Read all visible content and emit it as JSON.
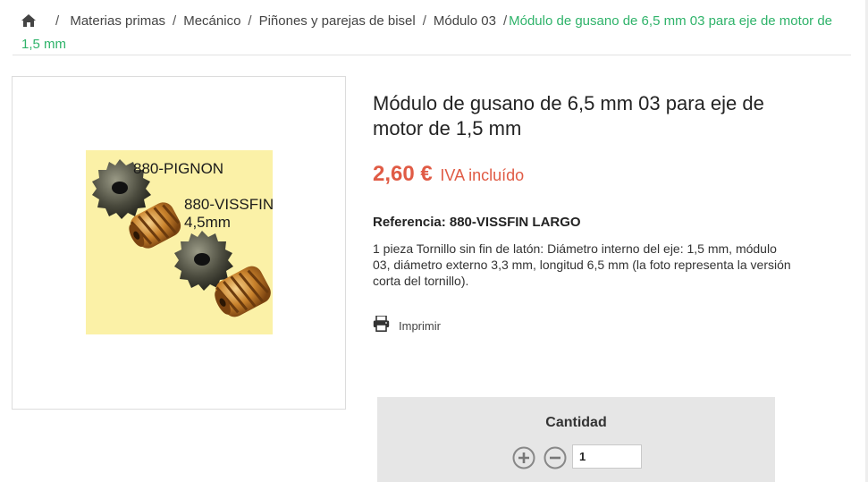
{
  "breadcrumb": {
    "home_icon": "home-icon",
    "items": [
      "Materias primas",
      "Mecánico",
      "Piñones y parejas de bisel",
      "Módulo 03"
    ],
    "current": "Módulo de gusano de 6,5 mm 03 para eje de motor de 1,5 mm"
  },
  "image": {
    "labels": {
      "top": "880-PIGNON",
      "middle1": "880-VISSFIN",
      "middle2": "4,5mm"
    }
  },
  "product": {
    "title": "Módulo de gusano de 6,5 mm 03 para eje de motor de 1,5 mm",
    "price": "2,60 €",
    "tax_label": "IVA incluído",
    "reference_label": "Referencia:",
    "reference_value": "880-VISSFIN LARGO",
    "description": "1 pieza Tornillo sin fin de latón: Diámetro interno del eje: 1,5 mm, módulo 03, diámetro externo 3,3 mm, longitud 6,5 mm (la foto representa la versión corta del tornillo).",
    "print_label": "Imprimir",
    "print_icon": "printer-icon"
  },
  "quantity": {
    "title": "Cantidad",
    "value": "1",
    "increase_icon": "plus-circle-icon",
    "decrease_icon": "minus-circle-icon"
  },
  "colors": {
    "price": "#e05b45",
    "breadcrumb_current": "#2fb36a",
    "quantity_box": "#e6e6e6",
    "photo_background": "#fbf1a7"
  }
}
